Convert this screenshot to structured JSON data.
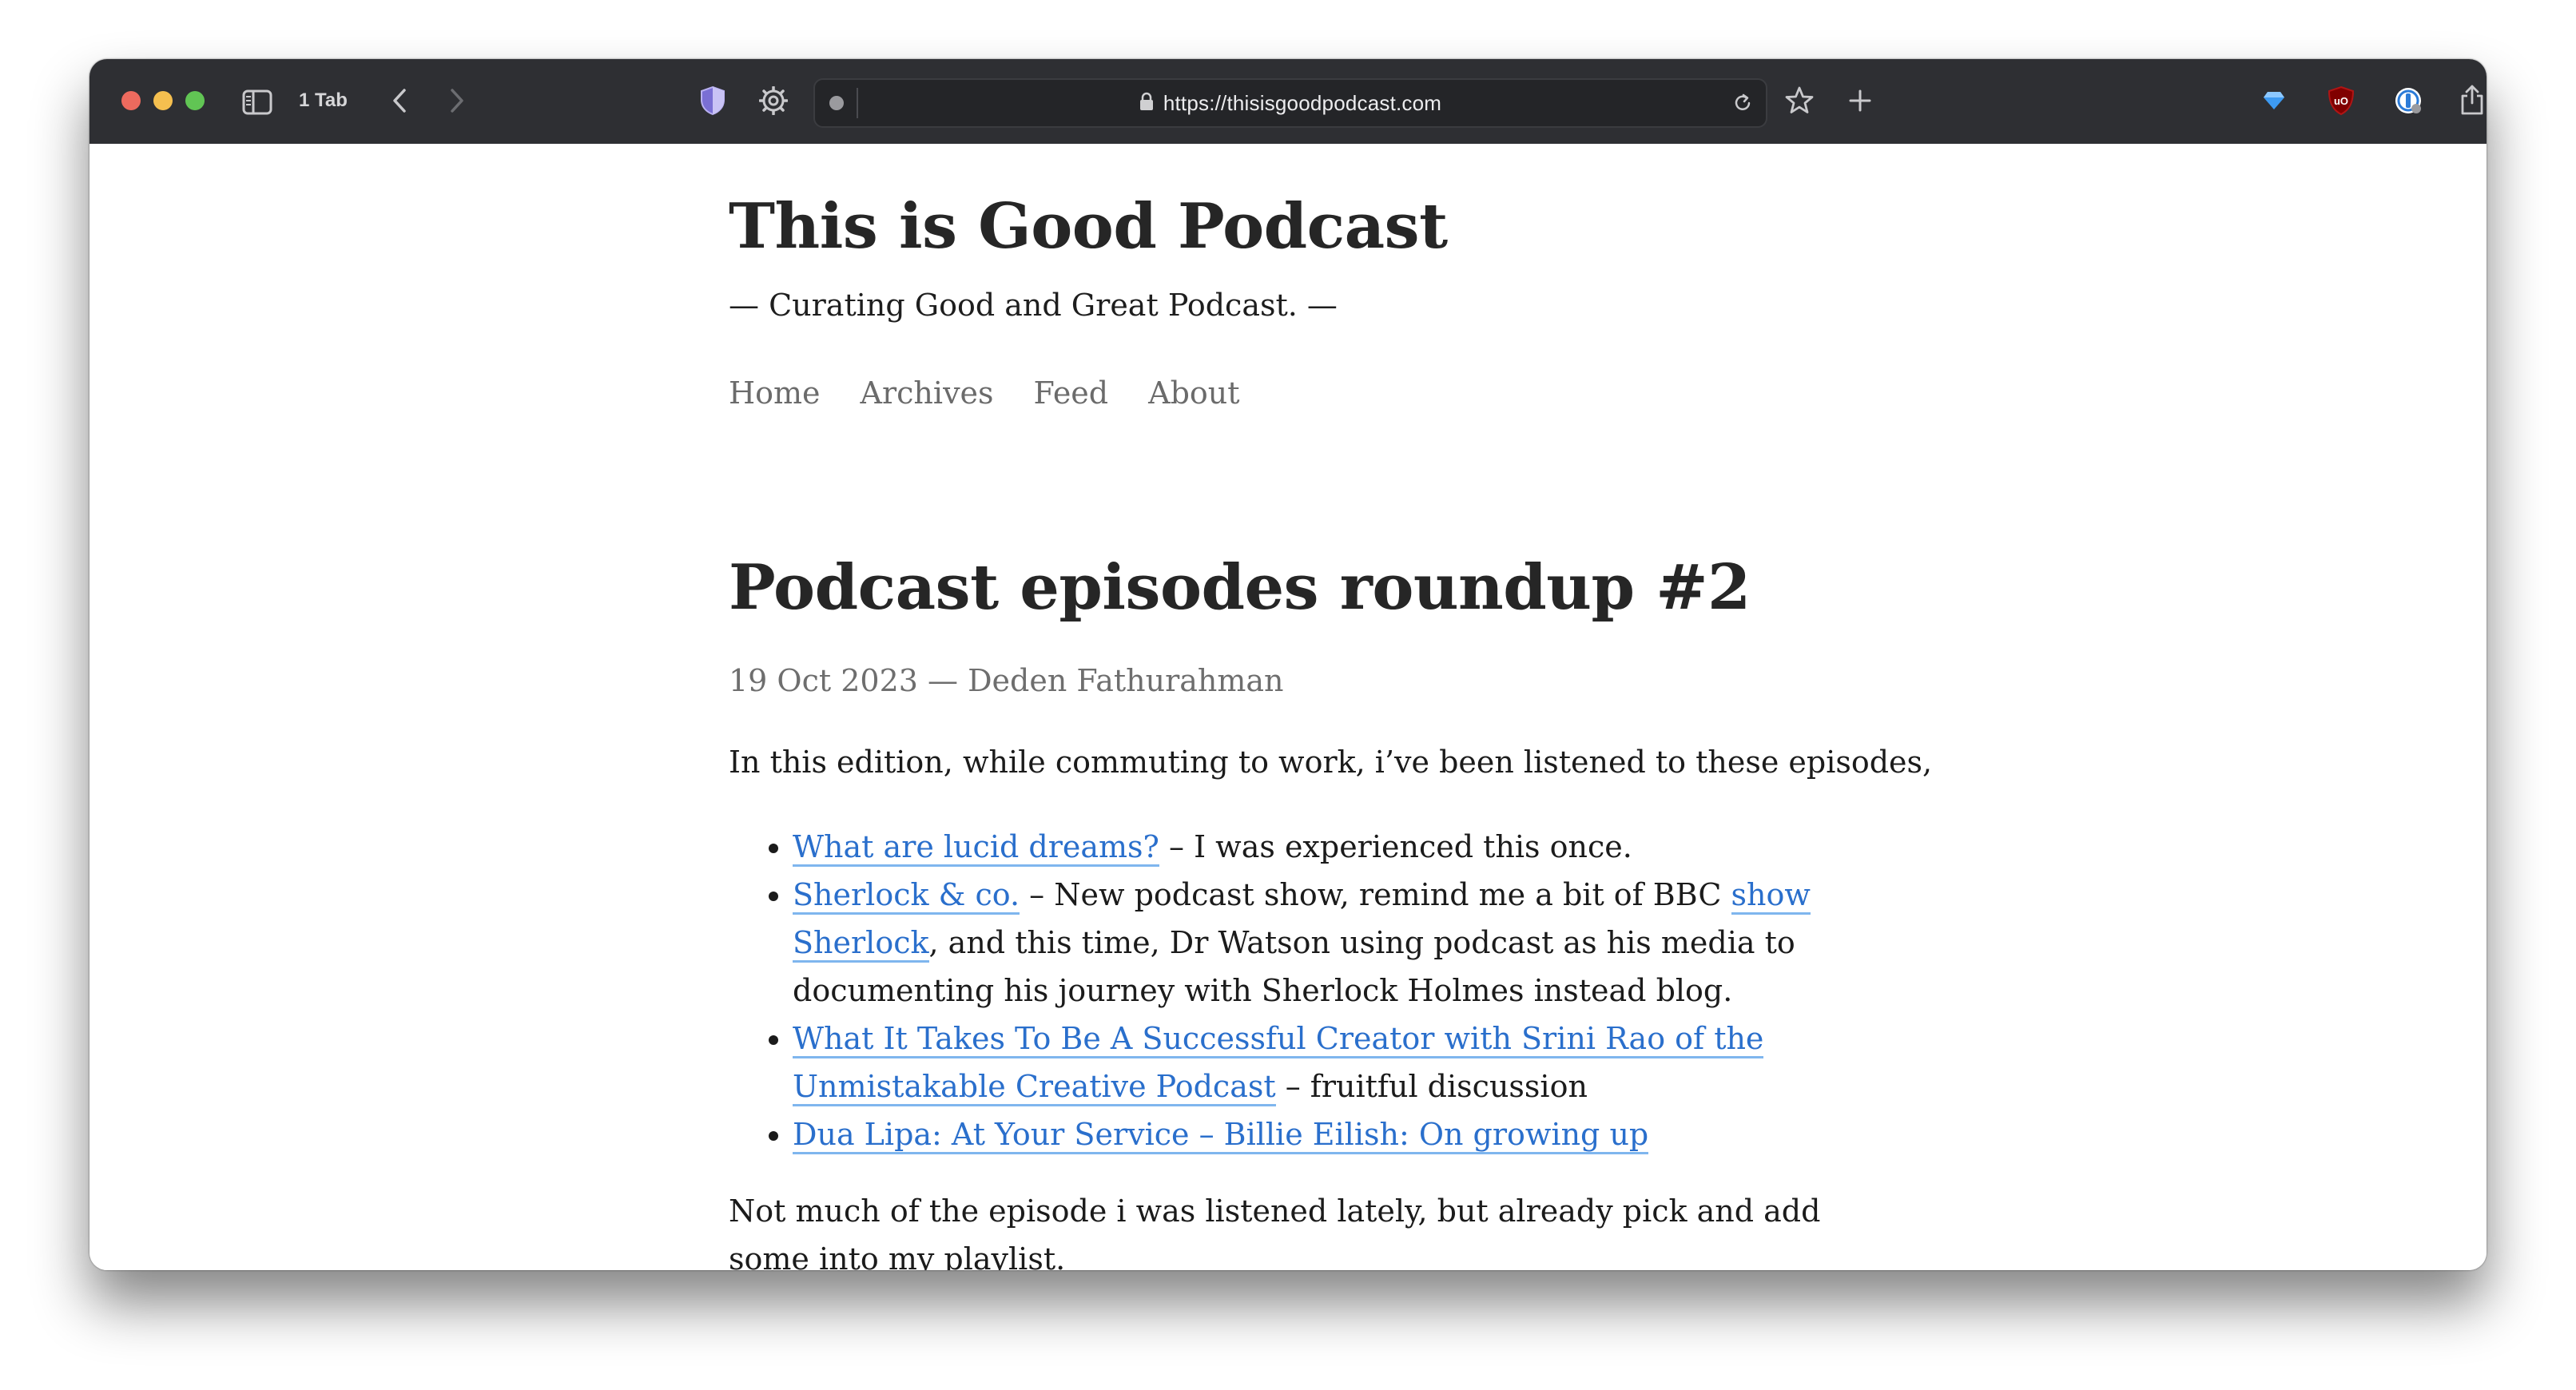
{
  "browser": {
    "tab_count": "1 Tab",
    "url": "https://thisisgoodpodcast.com"
  },
  "site": {
    "title": "This is Good Podcast",
    "tagline": "— Curating Good and Great Podcast. —",
    "nav": [
      "Home",
      "Archives",
      "Feed",
      "About"
    ]
  },
  "post": {
    "title": "Podcast episodes roundup #2",
    "meta": "19 Oct 2023 — Deden Fathurahman",
    "intro": "In this edition, while commuting to work, i’ve been listened to these episodes,",
    "items": [
      {
        "link": "What are lucid dreams?",
        "text": " – I was experienced this once."
      },
      {
        "link": "Sherlock & co.",
        "text_before": " – New podcast show, remind me a bit of BBC ",
        "link2": "show Sherlock",
        "text_after": ", and this time, Dr Watson using podcast as his media to documenting his journey with Sherlock Holmes instead blog."
      },
      {
        "link": "What It Takes To Be A Successful Creator with Srini Rao of the Unmistakable Creative Podcast",
        "text": " – fruitful discussion"
      },
      {
        "link": "Dua Lipa: At Your Service – Billie Eilish: On growing up"
      }
    ],
    "closing": "Not much of the episode i was listened lately, but already pick and add some into my playlist."
  },
  "colors": {
    "toolbar": "#2e2f33",
    "link": "#2a6fcc",
    "link_underline": "#7fb6ee",
    "nav_text": "#6b6b6b"
  }
}
